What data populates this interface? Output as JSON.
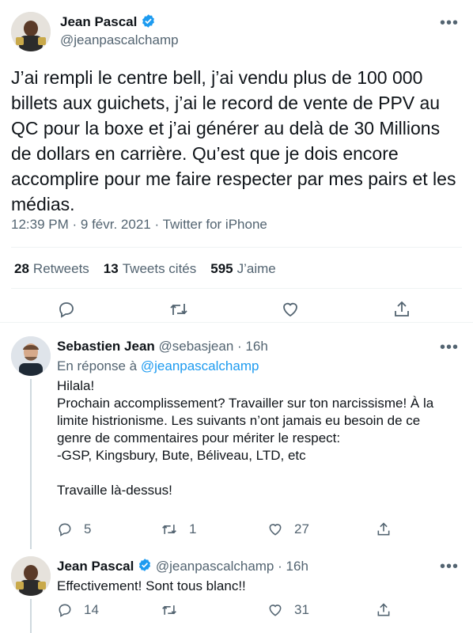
{
  "main_tweet": {
    "name": "Jean Pascal",
    "handle": "@jeanpascalchamp",
    "text": "J’ai rempli le centre bell, j’ai vendu plus de 100 000 billets aux guichets, j’ai le record de vente de PPV au QC pour la boxe et j’ai générer au delà de 30 Millions de dollars en carrière. Qu’est que je dois encore accomplire pour me faire respecter par mes pairs et les médias.",
    "time": "12:39 PM",
    "date": "9 févr. 2021",
    "source": "Twitter for iPhone",
    "separator": "·",
    "retweets_count": "28",
    "retweets_label": "Retweets",
    "quotes_count": "13",
    "quotes_label": "Tweets cités",
    "likes_count": "595",
    "likes_label": "J’aime"
  },
  "replies": [
    {
      "name": "Sebastien Jean",
      "handle": "@sebasjean",
      "time": "16h",
      "reply_prefix": "En réponse à",
      "reply_to": "@jeanpascalchamp",
      "text": "Hilala!\nProchain accomplissement? Travailler sur ton narcissisme! À la limite histrionisme. Les suivants n’ont jamais eu besoin de ce genre de commentaires pour mériter le respect:\n-GSP, Kingsbury, Bute, Béliveau, LTD, etc\n\nTravaille là-dessus!",
      "reply_count": "5",
      "retweet_count": "1",
      "like_count": "27"
    },
    {
      "name": "Jean Pascal",
      "handle": "@jeanpascalchamp",
      "time": "16h",
      "text": "Effectivement! Sont tous blanc!!",
      "reply_count": "14",
      "retweet_count": "",
      "like_count": "31"
    }
  ],
  "colors": {
    "accent": "#1d9bf0",
    "text": "#0f1419",
    "secondary": "#536471",
    "border": "#eff3f4"
  },
  "icons": [
    "verified-badge-icon",
    "more-icon",
    "reply-icon",
    "retweet-icon",
    "like-icon",
    "share-icon"
  ]
}
